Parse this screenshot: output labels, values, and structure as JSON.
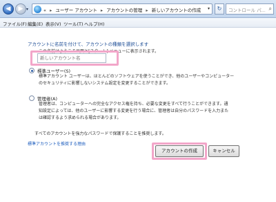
{
  "addressbar": {
    "prefix": "«",
    "crumbs": [
      "ユーザー アカウント",
      "アカウントの管理",
      "新しいアカウントの作成"
    ],
    "separator": "▸"
  },
  "search": {
    "placeholder": "コントロール パ..."
  },
  "menu": [
    "ファイル(F)",
    "編集(E)",
    "表示(V)",
    "ツール(T)",
    "ヘルプ(H)"
  ],
  "content": {
    "heading": "アカウントに名前を付けて、アカウントの種類を選択します",
    "description": "この名前はようこそ画面と[スタート] メニューに表示されます。",
    "name_placeholder": "新しいアカウント名",
    "options": [
      {
        "label": "標準ユーザー(S)",
        "selected": true,
        "desc_lines": [
          "標準アカウント ユーザーは、ほとんどのソフトウェアを使うことができ、他のユーザーやコンピューター",
          "のセキュリティに影響しないシステム設定を変更することができます。"
        ]
      },
      {
        "label": "管理者(A)",
        "selected": false,
        "desc_lines": [
          "管理者は、コンピューターへの完全なアクセス権を持ち、必要な変更をすべて行うことができます。通",
          "知設定によっては、他のユーザーに影響する変更を行う場合に、管理者は自分のパスワードを入力また",
          "は確認するよう求められる場合があります。"
        ]
      }
    ],
    "note": "すべてのアカウントを強力なパスワードで保護することを推奨します。",
    "link": "標準アカウントを推奨する理由"
  },
  "buttons": {
    "create": "アカウントの作成",
    "cancel": "キャンセル"
  },
  "colors": {
    "heading": "#1e4e96",
    "link": "#1f5fbf",
    "highlight": "#f2a6c9"
  }
}
